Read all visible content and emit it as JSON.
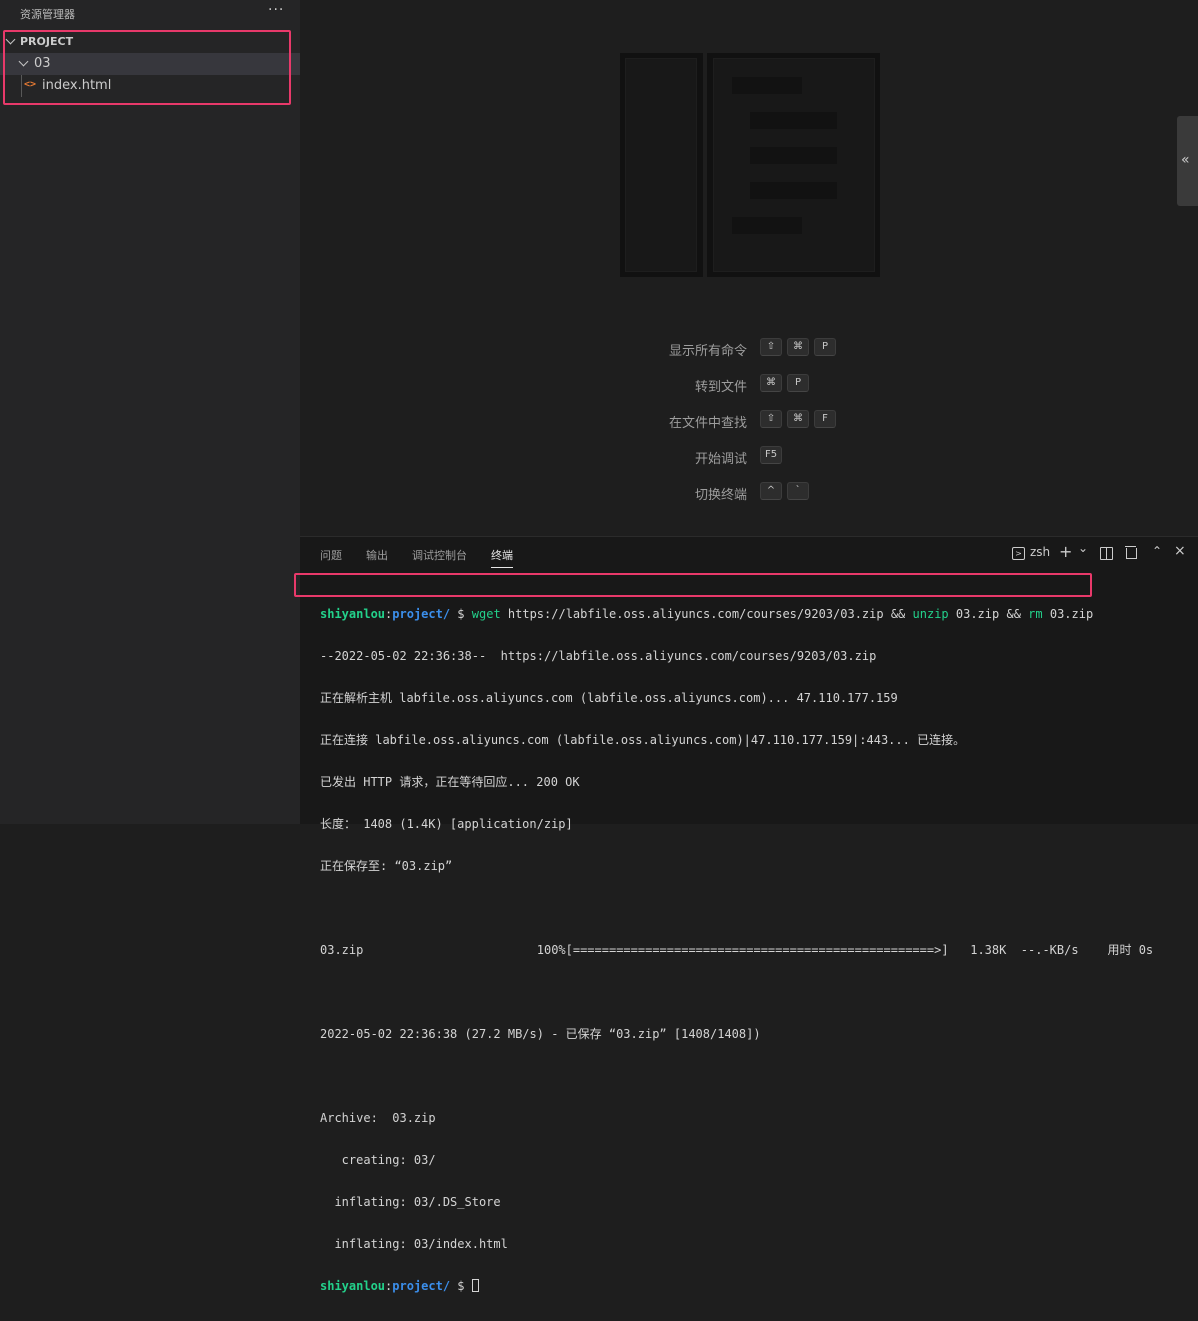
{
  "sidebar": {
    "title": "资源管理器",
    "more": "···",
    "project": "PROJECT",
    "folder": "03",
    "file": "index.html",
    "file_icon": "<>"
  },
  "editor": {
    "shortcuts": [
      {
        "label": "显示所有命令",
        "keys": [
          "⇧",
          "⌘",
          "P"
        ]
      },
      {
        "label": "转到文件",
        "keys": [
          "⌘",
          "P"
        ]
      },
      {
        "label": "在文件中查找",
        "keys": [
          "⇧",
          "⌘",
          "F"
        ]
      },
      {
        "label": "开始调试",
        "keys": [
          "F5"
        ]
      },
      {
        "label": "切换终端",
        "keys": [
          "^",
          "`"
        ]
      }
    ],
    "collapse_glyph": "«"
  },
  "panel": {
    "tabs": [
      "问题",
      "输出",
      "调试控制台",
      "终端"
    ],
    "active_tab": "终端",
    "shell": "zsh",
    "add": "+",
    "dropdown": "⌄",
    "maximize": "⌃",
    "close": "×"
  },
  "terminal": {
    "prompt_user": "shiyanlou",
    "prompt_path": "project/",
    "prompt_symbol": "$",
    "command_parts": {
      "wget": "wget",
      "url": "https://labfile.oss.aliyuncs.com/courses/9203/03.zip",
      "and1": "&&",
      "unzip": "unzip",
      "zip_arg": "03.zip",
      "and2": "&&",
      "rm": "rm",
      "rm_arg": "03.zip"
    },
    "output_lines": [
      "--2022-05-02 22:36:38--  https://labfile.oss.aliyuncs.com/courses/9203/03.zip",
      "正在解析主机 labfile.oss.aliyuncs.com (labfile.oss.aliyuncs.com)... 47.110.177.159",
      "正在连接 labfile.oss.aliyuncs.com (labfile.oss.aliyuncs.com)|47.110.177.159|:443... 已连接。",
      "已发出 HTTP 请求，正在等待回应... 200 OK",
      "长度： 1408 (1.4K) [application/zip]",
      "正在保存至: “03.zip”",
      "",
      "03.zip                        100%[==================================================>]   1.38K  --.-KB/s    用时 0s",
      "",
      "2022-05-02 22:36:38 (27.2 MB/s) - 已保存 “03.zip” [1408/1408])",
      "",
      "Archive:  03.zip",
      "   creating: 03/",
      "  inflating: 03/.DS_Store",
      "  inflating: 03/index.html"
    ]
  }
}
